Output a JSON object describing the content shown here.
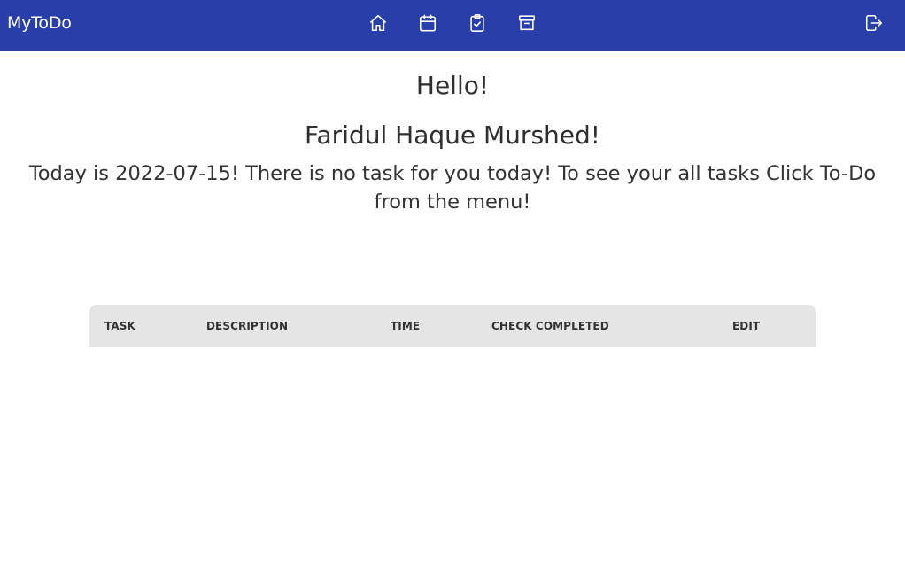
{
  "navbar": {
    "brand": "MyToDo",
    "icons": [
      "home-icon",
      "calendar-icon",
      "clipboard-check-icon",
      "archive-icon"
    ],
    "logout_icon": "logout-icon",
    "background_color": "#283ea9"
  },
  "greeting": {
    "hello": "Hello!",
    "name": "Faridul Haque Murshed!",
    "message": "Today is 2022-07-15! There is no task for you today! To see your all tasks Click To-Do from the menu!"
  },
  "table": {
    "headers": [
      "TASK",
      "DESCRIPTION",
      "TIME",
      "CHECK COMPLETED",
      "EDIT"
    ],
    "rows": [],
    "header_background": "#e5e5e5"
  }
}
